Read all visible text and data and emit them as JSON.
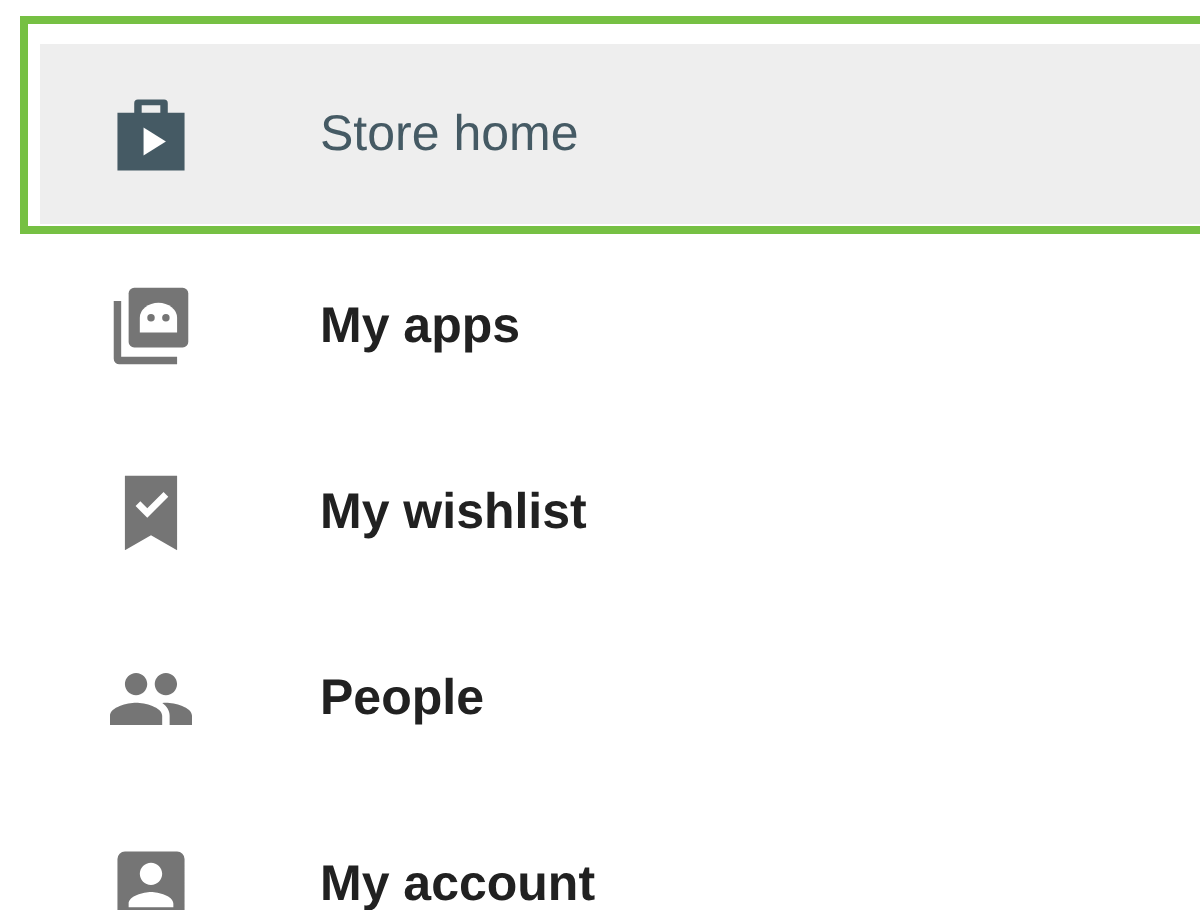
{
  "menu": {
    "items": [
      {
        "label": "Store home",
        "kind": "store",
        "selected": true
      },
      {
        "label": "My apps",
        "kind": "apps",
        "selected": false
      },
      {
        "label": "My wishlist",
        "kind": "wishlist",
        "selected": false
      },
      {
        "label": "People",
        "kind": "people",
        "selected": false
      },
      {
        "label": "My account",
        "kind": "account",
        "selected": false
      }
    ]
  }
}
